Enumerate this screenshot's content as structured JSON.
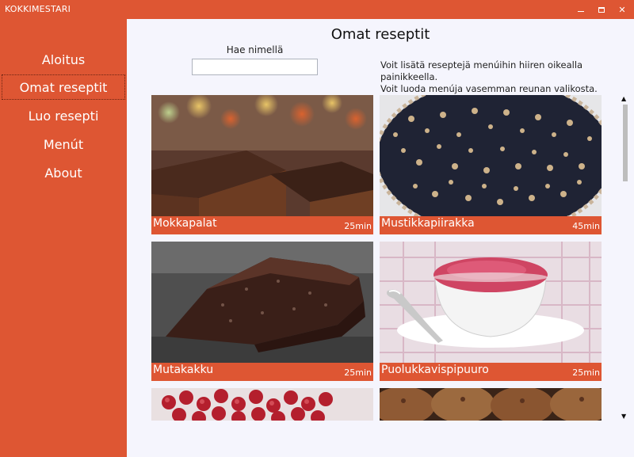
{
  "window": {
    "title": "KOKKIMESTARI"
  },
  "sidebar": {
    "items": [
      {
        "label": "Aloitus",
        "selected": false
      },
      {
        "label": "Omat reseptit",
        "selected": true
      },
      {
        "label": "Luo resepti",
        "selected": false
      },
      {
        "label": "Menút",
        "selected": false
      },
      {
        "label": "About",
        "selected": false
      }
    ]
  },
  "main": {
    "title": "Omat reseptit",
    "search": {
      "label": "Hae nimellä",
      "value": ""
    },
    "help_lines": [
      "Voit lisätä reseptejä menúihin hiiren oikealla painikkeella.",
      "Voit luoda menúja vasemman reunan valikosta."
    ],
    "recipes": [
      {
        "name": "Mokkapalat",
        "time": "25min"
      },
      {
        "name": "Mustikkapiirakka",
        "time": "45min"
      },
      {
        "name": "Mutakakku",
        "time": "25min"
      },
      {
        "name": "Puolukkavispipuuro",
        "time": "25min"
      }
    ]
  },
  "colors": {
    "accent": "#de5633",
    "content_bg": "#f5f5fd"
  }
}
